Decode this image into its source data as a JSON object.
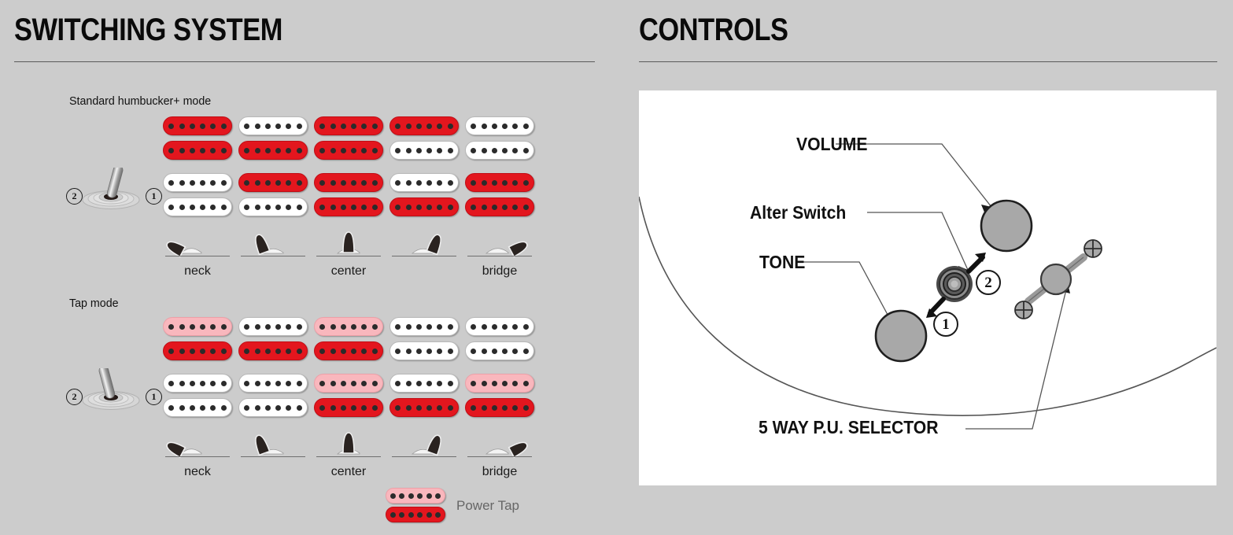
{
  "sections": [
    {
      "id": "switching",
      "title": "SWITCHING SYSTEM"
    },
    {
      "id": "controls",
      "title": "CONTROLS"
    }
  ],
  "switching": {
    "modes": [
      {
        "name": "Standard humbucker+ mode",
        "switch": {
          "left_label": "2",
          "right_label": "1",
          "lever_direction": "right"
        },
        "rows": [
          {
            "position": "2",
            "pickups": [
              {
                "top": "red",
                "bottom": "red"
              },
              {
                "top": "white",
                "bottom": "red"
              },
              {
                "top": "red",
                "bottom": "red"
              },
              {
                "top": "red",
                "bottom": "white"
              },
              {
                "top": "white",
                "bottom": "white"
              }
            ]
          },
          {
            "position": "1",
            "pickups": [
              {
                "top": "white",
                "bottom": "white"
              },
              {
                "top": "red",
                "bottom": "white"
              },
              {
                "top": "red",
                "bottom": "red"
              },
              {
                "top": "white",
                "bottom": "red"
              },
              {
                "top": "red",
                "bottom": "red"
              }
            ]
          }
        ],
        "selector_labels": [
          "neck",
          "",
          "center",
          "",
          "bridge"
        ]
      },
      {
        "name": "Tap mode",
        "switch": {
          "left_label": "2",
          "right_label": "1",
          "lever_direction": "left"
        },
        "rows": [
          {
            "position": "2",
            "pickups": [
              {
                "top": "pink",
                "bottom": "red"
              },
              {
                "top": "white",
                "bottom": "red"
              },
              {
                "top": "pink",
                "bottom": "red"
              },
              {
                "top": "white",
                "bottom": "white"
              },
              {
                "top": "white",
                "bottom": "white"
              }
            ]
          },
          {
            "position": "1",
            "pickups": [
              {
                "top": "white",
                "bottom": "white"
              },
              {
                "top": "white",
                "bottom": "white"
              },
              {
                "top": "pink",
                "bottom": "red"
              },
              {
                "top": "white",
                "bottom": "red"
              },
              {
                "top": "pink",
                "bottom": "red"
              }
            ]
          }
        ],
        "selector_labels": [
          "neck",
          "",
          "center",
          "",
          "bridge"
        ]
      }
    ],
    "legend": {
      "label": "Power Tap",
      "top": "pink",
      "bottom": "red"
    }
  },
  "controls": {
    "labels": [
      {
        "id": "volume",
        "text": "VOLUME",
        "size": 23
      },
      {
        "id": "alter-switch",
        "text": "Alter Switch",
        "size": 23
      },
      {
        "id": "tone",
        "text": "TONE",
        "size": 23
      },
      {
        "id": "selector",
        "text": "5 WAY P.U. SELECTOR",
        "size": 23
      }
    ],
    "switch_positions": [
      {
        "label": "1"
      },
      {
        "label": "2"
      }
    ]
  },
  "colors": {
    "background": "#cccccc",
    "panel": "#ffffff",
    "coil_red": "#e3161e",
    "coil_pink": "#f9b7bd",
    "coil_white": "#ffffff",
    "knob_gray": "#a8a8a8",
    "text_dark": "#111111",
    "legend_text": "#666666",
    "rule": "#5a5a5a"
  }
}
